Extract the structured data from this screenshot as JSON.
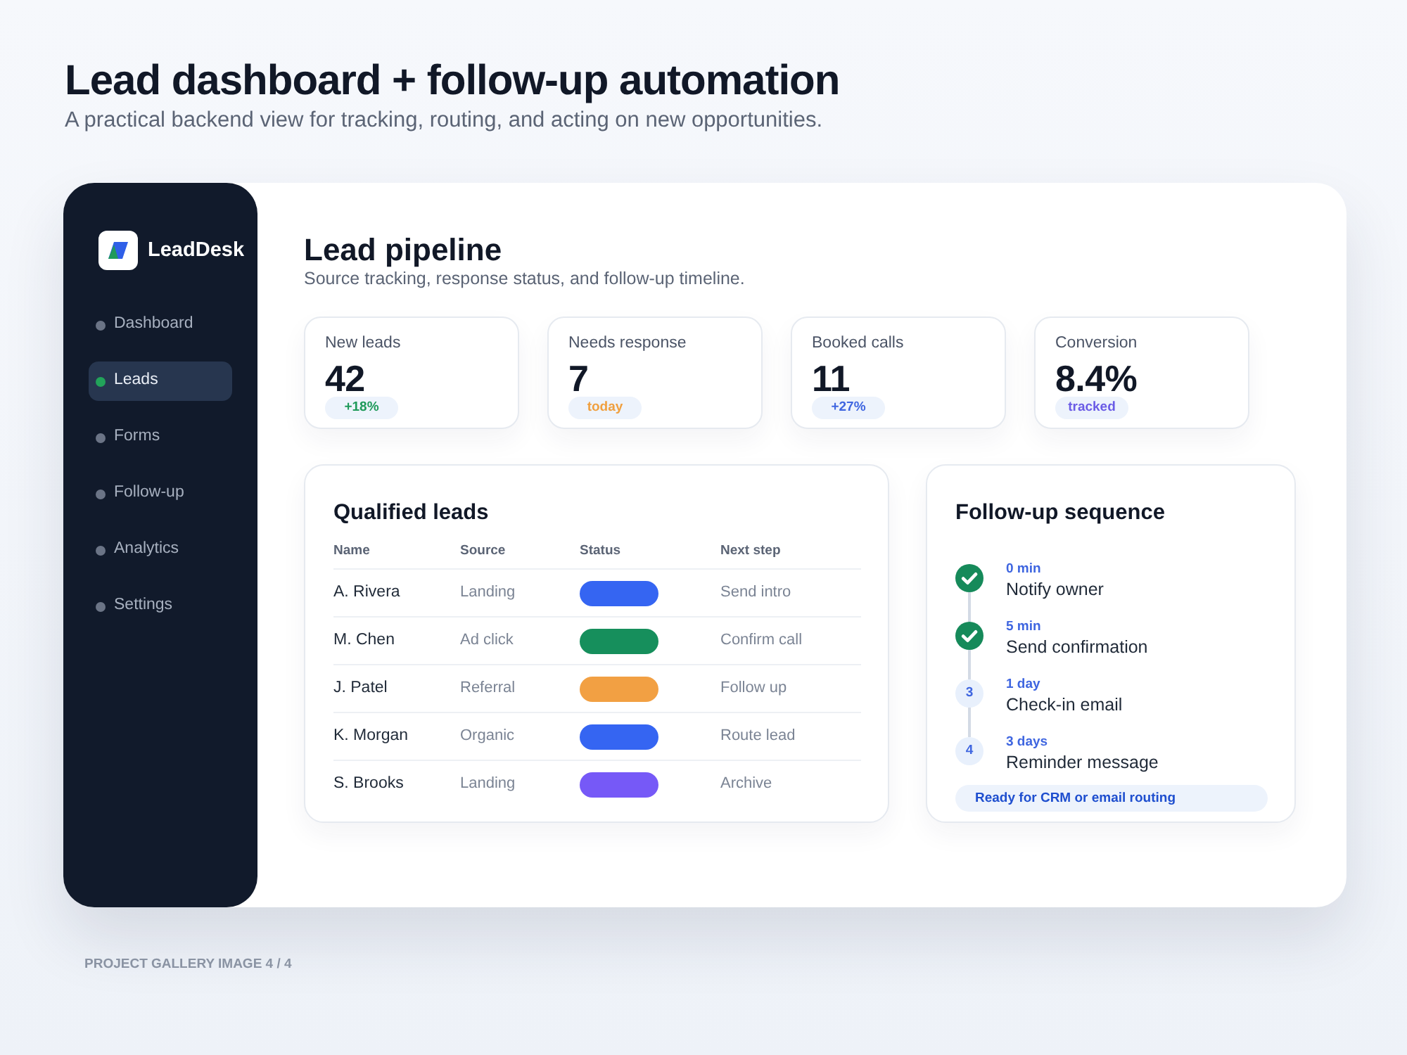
{
  "page": {
    "title": "Lead dashboard + follow-up automation",
    "subtitle": "A practical backend view for tracking, routing, and acting on new opportunities."
  },
  "sidebar": {
    "brand": "LeadDesk",
    "items": [
      {
        "label": "Dashboard",
        "selected": false
      },
      {
        "label": "Leads",
        "selected": true
      },
      {
        "label": "Forms",
        "selected": false
      },
      {
        "label": "Follow-up",
        "selected": false
      },
      {
        "label": "Analytics",
        "selected": false
      },
      {
        "label": "Settings",
        "selected": false
      }
    ]
  },
  "main": {
    "title": "Lead pipeline",
    "subtitle": "Source tracking, response status, and follow-up timeline."
  },
  "stats": [
    {
      "label": "New leads",
      "value": "42",
      "badge": "+18%",
      "color": "#1f9a5a"
    },
    {
      "label": "Needs response",
      "value": "7",
      "badge": "today",
      "color": "#f0a040"
    },
    {
      "label": "Booked calls",
      "value": "11",
      "badge": "+27%",
      "color": "#3f66e0"
    },
    {
      "label": "Conversion",
      "value": "8.4%",
      "badge": "tracked",
      "color": "#6b5ce6"
    }
  ],
  "leads_table": {
    "title": "Qualified leads",
    "columns": [
      "Name",
      "Source",
      "Status",
      "Next step"
    ],
    "rows": [
      {
        "name": "A. Rivera",
        "source": "Landing",
        "color": "#3565f2",
        "next_step": "Send intro"
      },
      {
        "name": "M. Chen",
        "source": "Ad click",
        "color": "#168f5c",
        "next_step": "Confirm call"
      },
      {
        "name": "J. Patel",
        "source": "Referral",
        "color": "#f2a043",
        "next_step": "Follow up"
      },
      {
        "name": "K. Morgan",
        "source": "Organic",
        "color": "#3565f2",
        "next_step": "Route lead"
      },
      {
        "name": "S. Brooks",
        "source": "Landing",
        "color": "#7659f7",
        "next_step": "Archive"
      }
    ]
  },
  "follow_up": {
    "title": "Follow-up sequence",
    "steps": [
      {
        "time": "0 min",
        "title": "Notify owner",
        "done": true
      },
      {
        "time": "5 min",
        "title": "Send confirmation",
        "done": true
      },
      {
        "time": "1 day",
        "title": "Check-in email",
        "done": false,
        "number": "3"
      },
      {
        "time": "3 days",
        "title": "Reminder message",
        "done": false,
        "number": "4"
      }
    ],
    "footer": "Ready for CRM or email routing"
  },
  "caption": "PROJECT GALLERY IMAGE 4 / 4"
}
